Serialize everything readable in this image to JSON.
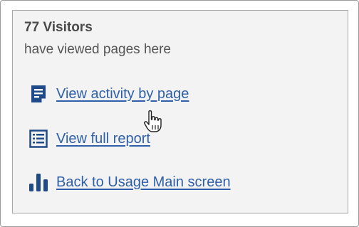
{
  "summary": {
    "count_label": "77 Visitors",
    "description": "have viewed pages here"
  },
  "links": [
    {
      "label": "View activity by page",
      "icon": "page-icon"
    },
    {
      "label": "View full report",
      "icon": "report-list-icon"
    },
    {
      "label": "Back to Usage Main screen",
      "icon": "bar-chart-icon"
    }
  ],
  "colors": {
    "link": "#2e5fa8",
    "icon": "#1f4a8a",
    "card_background": "#f3f3f3",
    "card_border": "#a8a8a8"
  },
  "cursor": {
    "icon": "hand-pointer-icon"
  }
}
